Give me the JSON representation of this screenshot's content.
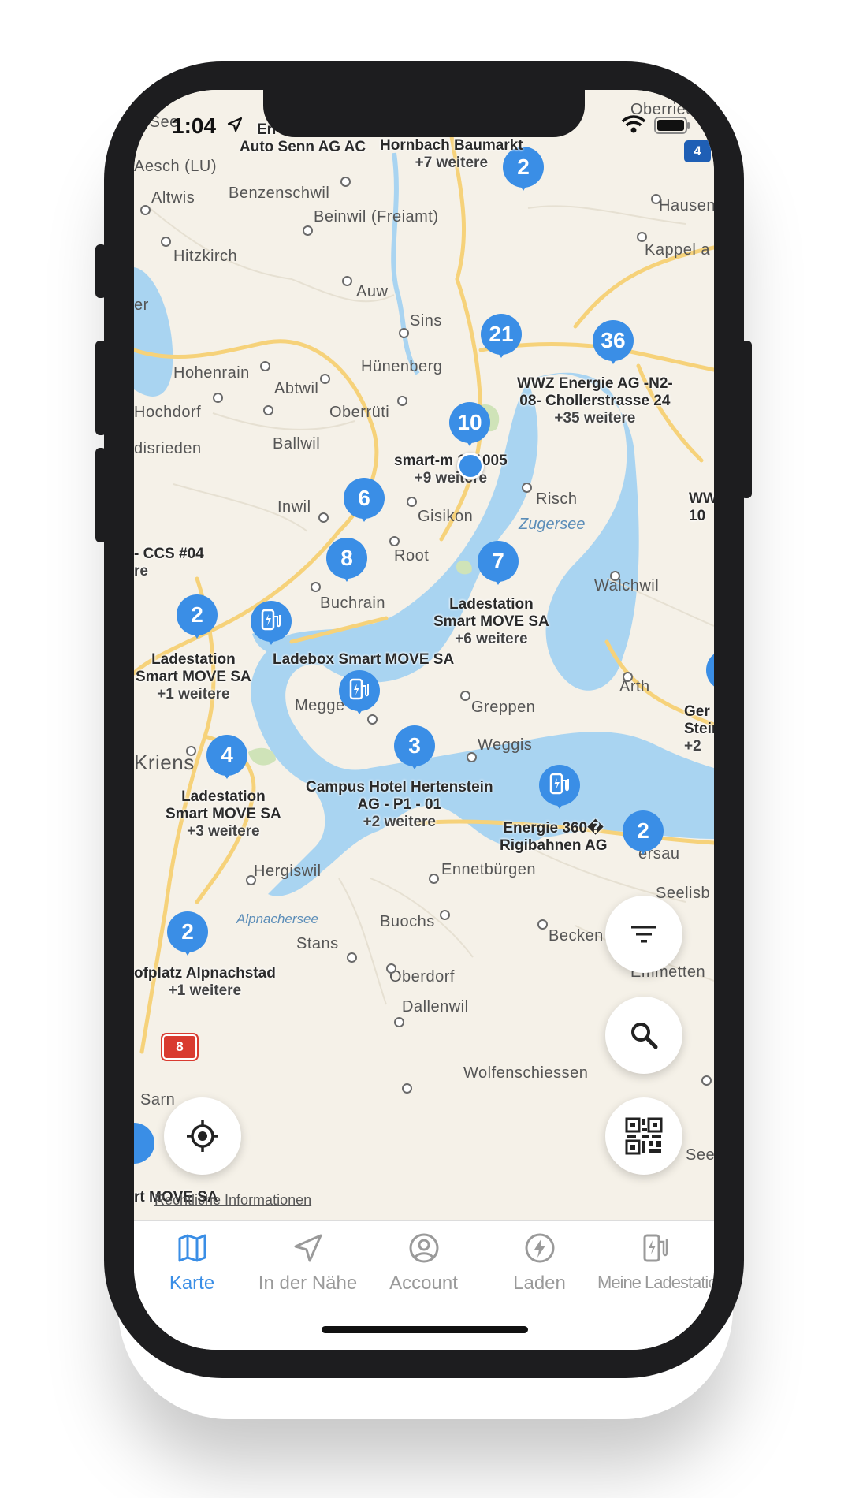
{
  "status_bar": {
    "time": "1:04"
  },
  "map": {
    "places": [
      {
        "id": "en-sep",
        "name": "n See"
      },
      {
        "id": "aesch",
        "name": "Aesch (LU)"
      },
      {
        "id": "altwis",
        "name": "Altwis"
      },
      {
        "id": "benzenschwil",
        "name": "Benzenschwil"
      },
      {
        "id": "beinwil",
        "name": "Beinwil (Freiamt)"
      },
      {
        "id": "hitzkirch",
        "name": "Hitzkirch"
      },
      {
        "id": "auw",
        "name": "Auw"
      },
      {
        "id": "sins",
        "name": "Sins"
      },
      {
        "id": "hohenrain",
        "name": "Hohenrain"
      },
      {
        "id": "huenenberg",
        "name": "Hünenberg"
      },
      {
        "id": "abtwil",
        "name": "Abtwil"
      },
      {
        "id": "hochdorf",
        "name": "Hochdorf"
      },
      {
        "id": "oberrueti",
        "name": "Oberrüti"
      },
      {
        "id": "ballwil",
        "name": "Ballwil"
      },
      {
        "id": "disrieden",
        "name": "disrieden"
      },
      {
        "id": "inwil",
        "name": "Inwil"
      },
      {
        "id": "gisikon",
        "name": "Gisikon"
      },
      {
        "id": "risch",
        "name": "Risch"
      },
      {
        "id": "root",
        "name": "Root"
      },
      {
        "id": "buchrain",
        "name": "Buchrain"
      },
      {
        "id": "walchwil",
        "name": "Walchwil"
      },
      {
        "id": "arth",
        "name": "Arth"
      },
      {
        "id": "greppen",
        "name": "Greppen"
      },
      {
        "id": "weggis",
        "name": "Weggis"
      },
      {
        "id": "kriens",
        "name": "Kriens"
      },
      {
        "id": "hergiswil",
        "name": "Hergiswil"
      },
      {
        "id": "ennetbuergen",
        "name": "Ennetbürgen"
      },
      {
        "id": "buochs",
        "name": "Buochs"
      },
      {
        "id": "stans",
        "name": "Stans"
      },
      {
        "id": "oberdorf",
        "name": "Oberdorf"
      },
      {
        "id": "dallenwil",
        "name": "Dallenwil"
      },
      {
        "id": "wolfenschiessen",
        "name": "Wolfenschiessen"
      },
      {
        "id": "hausen",
        "name": "Hausen"
      },
      {
        "id": "kappel",
        "name": "Kappel a"
      },
      {
        "id": "oberrieden",
        "name": "Oberried"
      },
      {
        "id": "megger",
        "name": "Megge"
      },
      {
        "id": "becken",
        "name": "Becken"
      },
      {
        "id": "seelisb",
        "name": "Seelisb"
      },
      {
        "id": "emmetten",
        "name": "Emmetten"
      },
      {
        "id": "sarn",
        "name": "Sarn"
      },
      {
        "id": "see",
        "name": "See"
      },
      {
        "id": "er",
        "name": "er"
      },
      {
        "id": "gersau",
        "name": "ersau"
      }
    ],
    "lakes": {
      "zugersee": "Zugersee",
      "alpnachersee": "Alpnachersee"
    },
    "road_shields": {
      "a4": "4",
      "a8": "8"
    },
    "clusters": [
      {
        "id": "c2-top",
        "count": "2",
        "title": "Hornbach Baumarkt",
        "more": "+7 weitere"
      },
      {
        "id": "c21",
        "count": "21"
      },
      {
        "id": "c36",
        "count": "36",
        "title": "WWZ Energie AG -N2-\n08- Chollerstrasse 24",
        "more": "+35 weitere"
      },
      {
        "id": "c10",
        "count": "10",
        "title": "smart-m 101005",
        "more": "+9 weitere"
      },
      {
        "id": "c6",
        "count": "6"
      },
      {
        "id": "c8",
        "count": "8"
      },
      {
        "id": "c7",
        "count": "7",
        "title": "Ladestation\nSmart MOVE SA",
        "more": "+6 weitere"
      },
      {
        "id": "c2-left",
        "count": "2",
        "title": "Ladestation\nSmart MOVE SA",
        "more": "+1 weitere"
      },
      {
        "id": "c3",
        "count": "3",
        "title": "Campus Hotel Hertenstein\nAG - P1 - 01",
        "more": "+2 weitere"
      },
      {
        "id": "c4",
        "count": "4",
        "title": "Ladestation\nSmart MOVE SA",
        "more": "+3 weitere"
      },
      {
        "id": "c2-right",
        "count": "2"
      },
      {
        "id": "c2-bottom",
        "count": "2",
        "title": "ofplatz Alpnachstad",
        "more": "+1 weitere"
      }
    ],
    "stations": [
      {
        "id": "s-ladebox",
        "title": "Ladebox Smart MOVE SA"
      },
      {
        "id": "s-megger",
        "title": ""
      },
      {
        "id": "s-energie",
        "title": "Energie 360�\nRigibahnen AG"
      }
    ],
    "edge_labels": {
      "top_left": "Auto Senn AG AC",
      "top_left_prefix": "En",
      "ccs": "- CCS #04",
      "ccs_sub": "re",
      "ww": "WW",
      "ww_sub": "10",
      "ger": "Ger",
      "steinerb": "Steinerb",
      "plus2": "+2",
      "bottom_left": "rt MOVE SA"
    },
    "legal_link": "Rechtliche Informationen"
  },
  "fabs": {
    "filter": "filter-icon",
    "search": "search-icon",
    "qr": "qr-code-icon",
    "locate": "locate-icon"
  },
  "tabbar": {
    "tabs": [
      {
        "label": "Karte",
        "icon": "map-icon",
        "active": true
      },
      {
        "label": "In der Nähe",
        "icon": "navigation-arrow-icon",
        "active": false
      },
      {
        "label": "Account",
        "icon": "account-icon",
        "active": false
      },
      {
        "label": "Laden",
        "icon": "bolt-icon",
        "active": false
      },
      {
        "label": "Meine Ladestation",
        "icon": "charging-station-icon",
        "active": false
      }
    ]
  },
  "colors": {
    "accent": "#3a8ee6",
    "water": "#a9d4f1",
    "land": "#f5f1e8",
    "road": "#f6d27a"
  }
}
